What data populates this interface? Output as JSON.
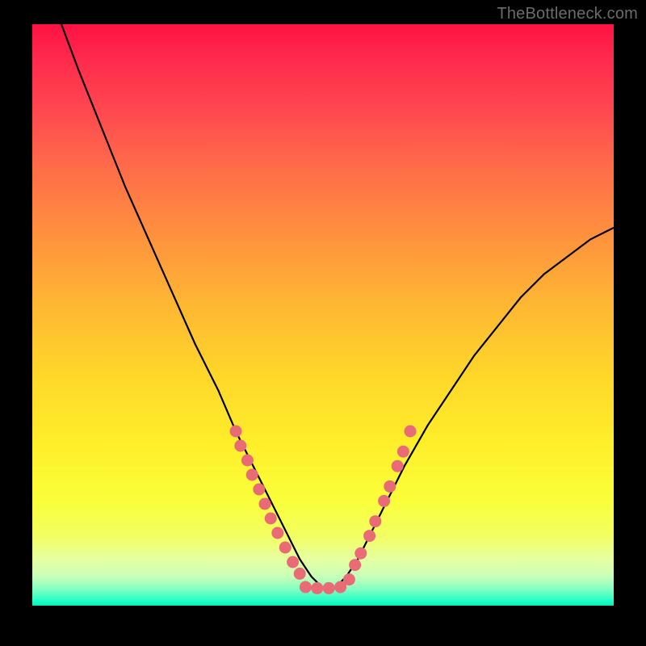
{
  "watermark": {
    "text": "TheBottleneck.com"
  },
  "chart_data": {
    "type": "line",
    "title": "",
    "xlabel": "",
    "ylabel": "",
    "xlim": [
      0,
      100
    ],
    "ylim": [
      0,
      100
    ],
    "series": [
      {
        "name": "bottleneck-curve",
        "x": [
          5,
          8,
          12,
          16,
          20,
          24,
          28,
          32,
          35,
          38,
          41,
          43.5,
          46,
          48,
          50,
          52,
          54,
          56,
          58,
          60,
          64,
          68,
          72,
          76,
          80,
          84,
          88,
          92,
          96,
          100
        ],
        "y": [
          100,
          92,
          82,
          72,
          63,
          54,
          45,
          37,
          30,
          24,
          18,
          13,
          8,
          5,
          3,
          3,
          5,
          8,
          12,
          16,
          24,
          31,
          37,
          43,
          48,
          53,
          57,
          60,
          63,
          65
        ]
      }
    ],
    "annotations": {
      "markers_left": [
        {
          "x": 35.0,
          "y": 30.0
        },
        {
          "x": 35.8,
          "y": 27.5
        },
        {
          "x": 37.0,
          "y": 25.0
        },
        {
          "x": 37.8,
          "y": 22.5
        },
        {
          "x": 39.0,
          "y": 20.0
        },
        {
          "x": 40.0,
          "y": 17.5
        },
        {
          "x": 41.0,
          "y": 15.0
        },
        {
          "x": 42.2,
          "y": 12.5
        },
        {
          "x": 43.5,
          "y": 10.0
        },
        {
          "x": 44.8,
          "y": 7.5
        },
        {
          "x": 46.0,
          "y": 5.5
        }
      ],
      "markers_right": [
        {
          "x": 55.5,
          "y": 7.0
        },
        {
          "x": 56.5,
          "y": 9.0
        },
        {
          "x": 58.0,
          "y": 12.0
        },
        {
          "x": 59.0,
          "y": 14.5
        },
        {
          "x": 60.5,
          "y": 18.0
        },
        {
          "x": 61.5,
          "y": 20.5
        },
        {
          "x": 62.8,
          "y": 24.0
        },
        {
          "x": 63.8,
          "y": 26.5
        },
        {
          "x": 65.0,
          "y": 30.0
        }
      ],
      "markers_bottom": [
        {
          "x": 47.0,
          "y": 3.2
        },
        {
          "x": 49.0,
          "y": 3.0
        },
        {
          "x": 51.0,
          "y": 3.0
        },
        {
          "x": 53.0,
          "y": 3.2
        },
        {
          "x": 54.5,
          "y": 4.5
        }
      ],
      "marker_color": "#e86b75",
      "curve_color": "#000000"
    }
  }
}
